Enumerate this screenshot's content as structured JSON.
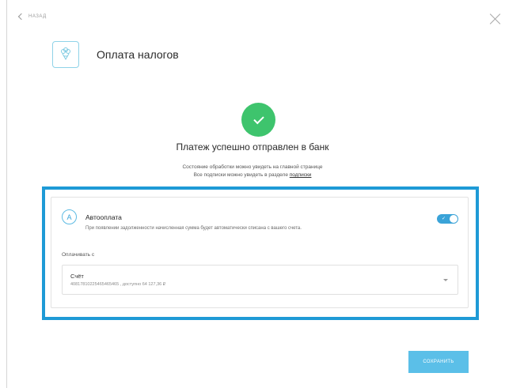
{
  "nav": {
    "back_label": "НАЗАД"
  },
  "header": {
    "title": "Оплата налогов",
    "service_icon": "cash-bouquet-icon"
  },
  "status": {
    "heading": "Платеж успешно отправлен в банк",
    "line1": "Состояние обработки можно увидеть на главной странице",
    "line2_prefix": "Все подписки можно увидеть в разделе ",
    "line2_link": "подписки"
  },
  "autopay": {
    "avatar_letter": "A",
    "title": "Автооплата",
    "description": "При появлении задолженности начисленная сумма будет автоматически списана с вашего счета.",
    "enabled": true
  },
  "pay_from": {
    "label": "Оплачивать с",
    "selected_title": "Счёт",
    "selected_value": "40817810225465465465 , доступно 64 127,36 ₽"
  },
  "actions": {
    "save_label": "СОХРАНИТЬ"
  },
  "colors": {
    "accent": "#1e9ad6",
    "success": "#3ec46d",
    "toggle": "#3aa3d8",
    "save_button": "#5bbfe8"
  }
}
